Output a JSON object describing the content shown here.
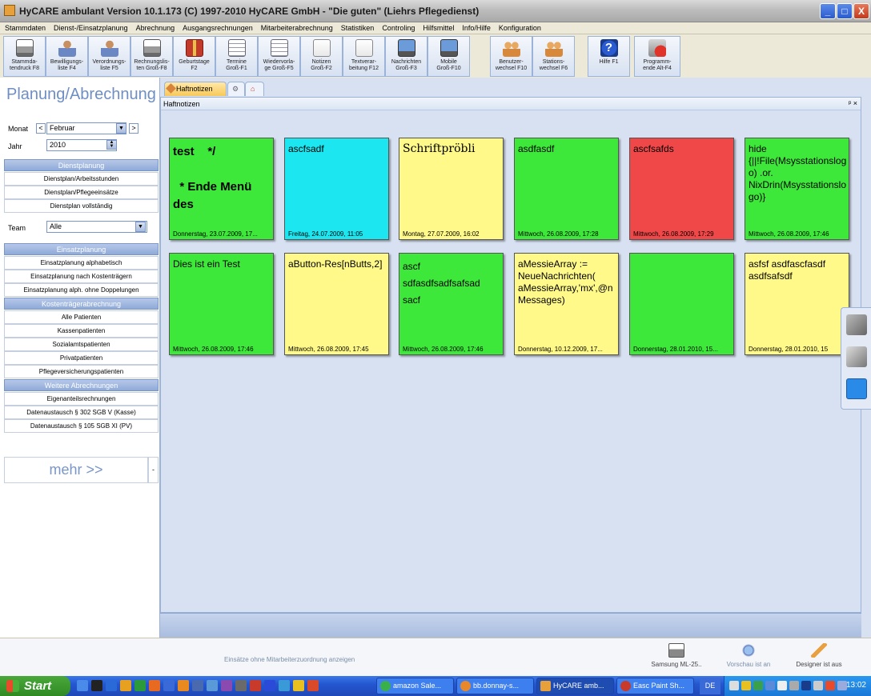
{
  "window": {
    "title": "HyCARE ambulant Version 10.1.173 (C) 1997-2010 HyCARE GmbH - \"Die guten\" (Liehrs Pflegedienst)",
    "min": "_",
    "max": "□",
    "close": "X"
  },
  "menu": [
    "Stammdaten",
    "Dienst-/Einsatzplanung",
    "Abrechnung",
    "Ausgangsrechnungen",
    "Mitarbeiterabrechnung",
    "Statistiken",
    "Controling",
    "Hilfsmittel",
    "Info/Hilfe",
    "Konfiguration"
  ],
  "toolbar": [
    {
      "label": "Stammda-\ntendruck F8",
      "icon": "printer-icon"
    },
    {
      "label": "Bewilligungs-\nliste F4",
      "icon": "person-icon"
    },
    {
      "label": "Verordnungs-\nliste F5",
      "icon": "person-icon"
    },
    {
      "label": "Rechnungslis-\nten Groß-F8",
      "icon": "printer-icon"
    },
    {
      "label": "Geburtstage\nF2",
      "icon": "gift-icon"
    },
    {
      "label": "Termine\nGroß-F1",
      "icon": "calendar-icon"
    },
    {
      "label": "Wiedervorla-\nge Groß-F5",
      "icon": "calendar-icon"
    },
    {
      "label": "Notizen\nGroß-F2",
      "icon": "note-icon"
    },
    {
      "label": "Textverar-\nbeitung F12",
      "icon": "note-icon"
    },
    {
      "label": "Nachrichten\nGroß-F3",
      "icon": "monitor-icon"
    },
    {
      "label": "Mobile\nGroß-F10",
      "icon": "monitor-icon"
    },
    {
      "label": "Benutzer-\nwechsel F10",
      "icon": "people-icon"
    },
    {
      "label": "Stations-\nwechsel F6",
      "icon": "people-icon"
    },
    {
      "label": "Hilfe F1",
      "icon": "help-icon"
    },
    {
      "label": "Programm-\nende Alt-F4",
      "icon": "exit-icon"
    }
  ],
  "left": {
    "title": "Planung/Abrechnung",
    "month_label": "Monat",
    "month_value": "Februar",
    "prev": "<",
    "next": ">",
    "year_label": "Jahr",
    "year_value": "2010",
    "team_label": "Team",
    "team_value": "Alle",
    "sections": [
      {
        "title": "Dienstplanung",
        "items": [
          "Dienstplan/Arbeitsstunden",
          "Dienstplan/Pflegeeinsätze",
          "Dienstplan vollständig"
        ]
      },
      {
        "title": "Einsatzplanung",
        "items": [
          "Einsatzplanung alphabetisch",
          "Einsatzplanung nach Kostenträgern",
          "Einsatzplanung alph. ohne Doppelungen"
        ]
      },
      {
        "title": "Kostenträgerabrechnung",
        "items": [
          "Alle Patienten",
          "Kassenpatienten",
          "Sozialamtspatienten",
          "Privatpatienten",
          "Pflegeversicherungspatienten"
        ]
      },
      {
        "title": "Weitere Abrechnungen",
        "items": [
          "Eigenanteilsrechnungen",
          "Datenaustausch § 302 SGB V (Kasse)",
          "Datenaustausch § 105 SGB XI (PV)"
        ]
      }
    ],
    "more": "mehr >>",
    "more_dd": "-"
  },
  "tabs": {
    "active": "Haftnotizen"
  },
  "notes_panel": {
    "title": "Haftnotizen",
    "controls": "ᵖ ×"
  },
  "notes": [
    {
      "text": "test    */\n\n  * Ende Menü des",
      "date": "Donnerstag, 23.07.2009, 17...",
      "color": "#3ee83a",
      "bold": true
    },
    {
      "text": "ascfsadf",
      "date": "Freitag, 24.07.2009, 11:05",
      "color": "#1ce6f0"
    },
    {
      "text": "Schriftpröbli",
      "date": "Montag, 27.07.2009, 16:02",
      "color": "#fff98a"
    },
    {
      "text": "asdfasdf",
      "date": "Mittwoch, 26.08.2009, 17:28",
      "color": "#3ee83a"
    },
    {
      "text": "ascfsafds",
      "date": "Mittwoch, 26.08.2009, 17:29",
      "color": "#f04848"
    },
    {
      "text": "hide {||!File(Msysstationslogo) .or. NixDrin(Msysstationslogo)}",
      "date": "Mittwoch, 26.08.2009, 17:46",
      "color": "#3ee83a"
    },
    {
      "text": "Dies ist ein Test",
      "date": "Mittwoch, 26.08.2009, 17:46",
      "color": "#3ee83a"
    },
    {
      "text": "aButton-Res[nButts,2]",
      "date": "Mittwoch, 26.08.2009, 17:45",
      "color": "#fff98a"
    },
    {
      "text": "ascf\nsdfasdfsadfsafsad\nsacf",
      "date": "Mittwoch, 26.08.2009, 17:46",
      "color": "#3ee83a"
    },
    {
      "text": "aMessieArray := NeueNachrichten( aMessieArray,'mx',@nMessages)",
      "date": "Donnerstag, 10.12.2009, 17...",
      "color": "#fff98a"
    },
    {
      "text": "",
      "date": "Donnerstag, 28.01.2010, 15...",
      "color": "#3ee83a"
    },
    {
      "text": "asfsf asdfascfasdf asdfsafsdf",
      "date": "Donnerstag, 28.01.2010, 15",
      "color": "#fff98a"
    }
  ],
  "status": {
    "hint": "Einsätze ohne Mitarbeiterzuordnung anzeigen",
    "items": [
      "Samsung ML-25..",
      "Vorschau ist an",
      "Designer ist aus"
    ]
  },
  "taskbar": {
    "start": "Start",
    "tasks": [
      "amazon Sale...",
      "bb.donnay-s...",
      "HyCARE amb...",
      "Easc Paint Sh..."
    ],
    "lang": "DE",
    "clock": "13:02"
  }
}
